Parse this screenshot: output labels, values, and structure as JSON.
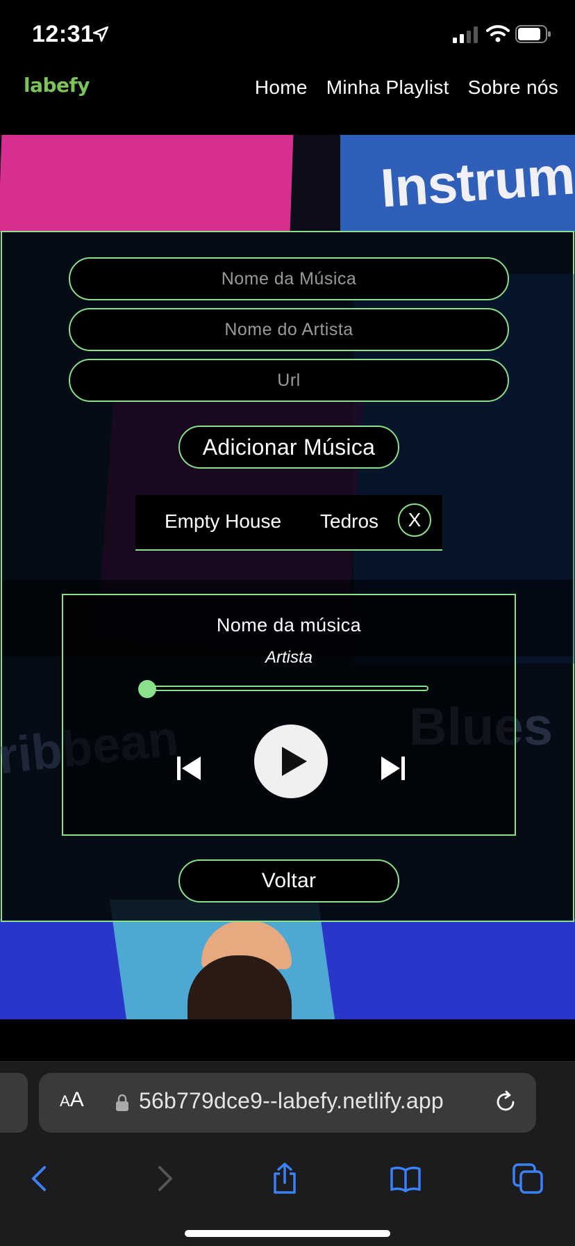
{
  "status_bar": {
    "time": "12:31"
  },
  "header": {
    "logo": "labefy",
    "nav": [
      {
        "label": "Home"
      },
      {
        "label": "Minha Playlist"
      },
      {
        "label": "Sobre nós"
      }
    ]
  },
  "background": {
    "tile_word_top": "Instrum",
    "tile_word_right": "Blues",
    "tile_word_left": "ribbean"
  },
  "form": {
    "song_name_placeholder": "Nome da Música",
    "artist_name_placeholder": "Nome do Artista",
    "url_placeholder": "Url",
    "add_button": "Adicionar Música"
  },
  "playlist": [
    {
      "song": "Empty House",
      "artist": "Tedros",
      "remove_label": "X"
    }
  ],
  "player": {
    "title": "Nome da música",
    "artist": "Artista",
    "progress": 0
  },
  "back_button": "Voltar",
  "browser": {
    "aa_label": "AA",
    "url": "56b779dce9--labefy.netlify.app"
  },
  "colors": {
    "accent": "#8be08b",
    "logo": "#7cc35a",
    "background": "#000000"
  }
}
